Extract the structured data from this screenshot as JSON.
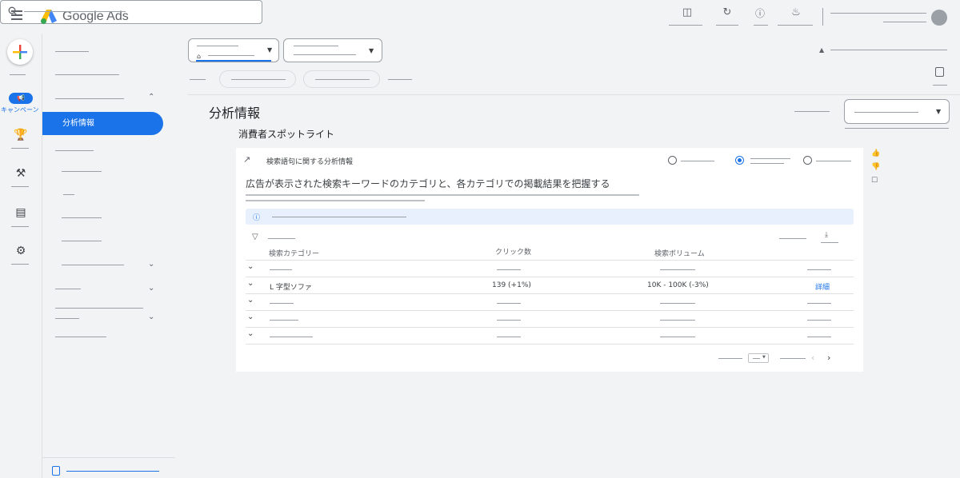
{
  "app": {
    "brand": "Google Ads"
  },
  "rail": {
    "campaign_label": "キャンペーン",
    "campaign_icon": "megaphone-icon"
  },
  "nav": {
    "active_label": "分析情報"
  },
  "page": {
    "title": "分析情報",
    "section_title": "消費者スポットライト"
  },
  "card": {
    "header": "検索語句に関する分析情報",
    "description": "広告が表示された検索キーワードのカテゴリと、各カテゴリでの掲載結果を把握する",
    "table": {
      "columns": [
        "検索カテゴリー",
        "クリック数",
        "検索ボリューム"
      ],
      "rows": [
        {
          "category": "L 字型ソファ",
          "clicks": "139 (+1%)",
          "volume": "10K - 100K (-3%)",
          "action": "詳細"
        }
      ]
    }
  },
  "colors": {
    "accent": "#1a73e8",
    "background": "#f1f3f4",
    "card": "#ffffff",
    "info": "#e8f0fe"
  }
}
